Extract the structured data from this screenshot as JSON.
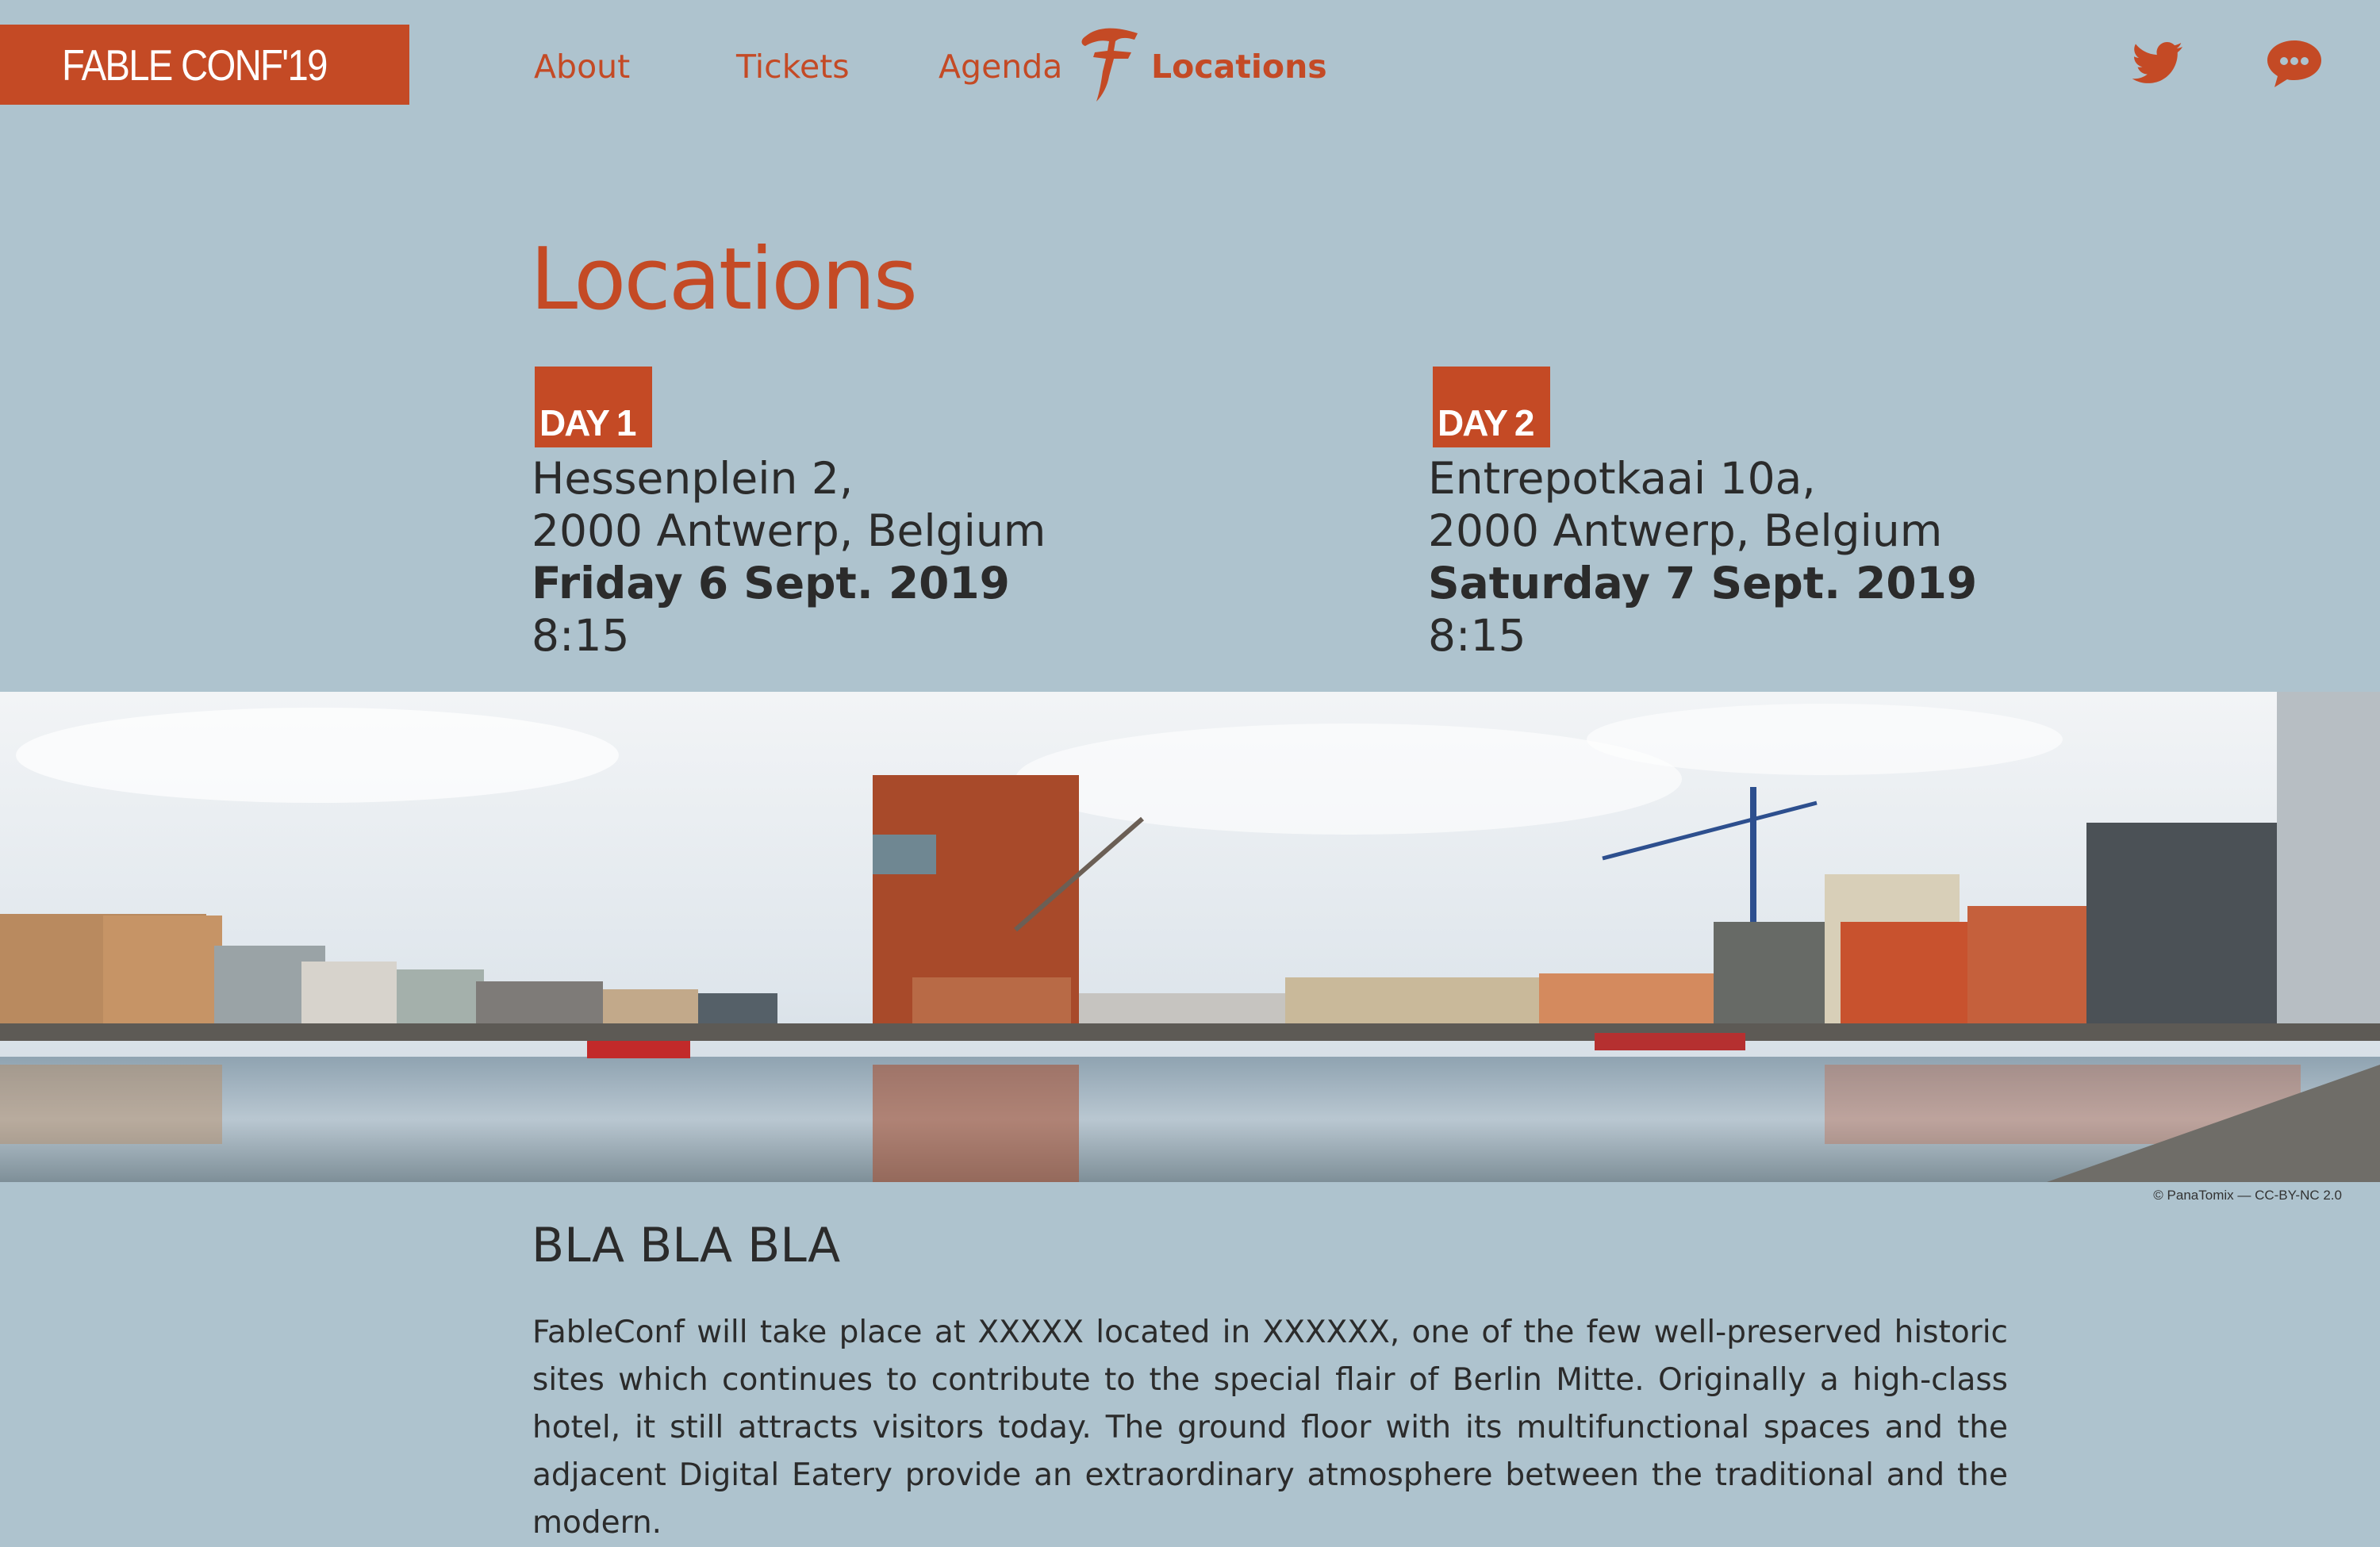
{
  "header": {
    "logo": "FABLE CONF'19",
    "nav": [
      {
        "label": "About"
      },
      {
        "label": "Tickets"
      },
      {
        "label": "Agenda"
      },
      {
        "label": "Locations",
        "active": true
      }
    ],
    "social_icons": [
      "twitter-icon",
      "chat-bubble-icon"
    ]
  },
  "main": {
    "title": "Locations",
    "days": [
      {
        "badge": "DAY 1",
        "address_line1": "Hessenplein 2,",
        "address_line2": "2000 Antwerp, Belgium",
        "date": "Friday 6 Sept. 2019",
        "time": "8:15"
      },
      {
        "badge": "DAY 2",
        "address_line1": "Entrepotkaai 10a,",
        "address_line2": "2000 Antwerp, Belgium",
        "date": "Saturday 7 Sept. 2019",
        "time": "8:15"
      }
    ],
    "photo_credit": "© PanaTomix — CC-BY-NC 2.0",
    "section_heading": "BLA BLA BLA",
    "body": "FableConf will take place at XXXXX located in XXXXXX, one of the few well-preserved historic sites which continues to contribute to the special flair of Berlin Mitte. Originally a high-class hotel, it still attracts visitors today. The ground floor with its multifunctional spaces and the adjacent Digital Eatery provide an extraordinary atmosphere between the traditional and the modern."
  },
  "colors": {
    "background": "#aec3ce",
    "accent": "#c44a25",
    "text": "#2b2b2b"
  }
}
